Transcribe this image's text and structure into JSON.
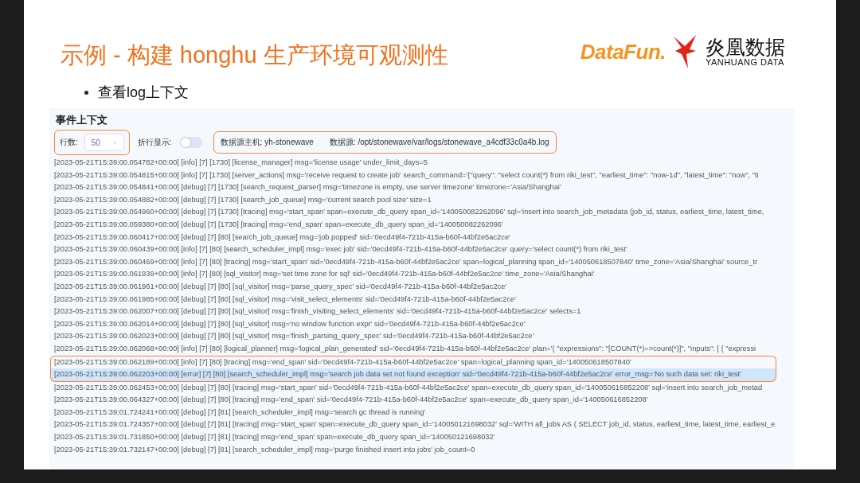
{
  "slide": {
    "title": "示例 - 构建 honghu 生产环境可观测性",
    "bullet": "查看log上下文"
  },
  "logo": {
    "brand": "DataFun.",
    "company": "炎凰数据",
    "company_en": "YANHUANG DATA"
  },
  "panel": {
    "title": "事件上下文",
    "toolbar": {
      "rows_label": "行数:",
      "rows_value": "50",
      "rows_annotated": true,
      "wrap_label": "折行显示:",
      "wrap_on": false,
      "host_label": "数据源主机:",
      "host_value": "yh-stonewave",
      "source_label": "数据源:",
      "source_value": "/opt/stonewave/var/logs/stonewave_a4cdf33c0a4b.log",
      "source_annotated": true
    },
    "rows": [
      {
        "text": "[2023-05-21T15:39:00.054782+00:00] [info] [7] [1730] [license_manager] msg='license usage' under_limit_days=5",
        "selected": false,
        "annotated": false
      },
      {
        "text": "[2023-05-21T15:39:00.054815+00:00] [info] [7] [1730] [server_actions] msg='receive request to create job' search_command='{\"query\": \"select count(*) from riki_test\", \"earliest_time\": \"now-1d\", \"latest_time\": \"now\", \"ti",
        "selected": false,
        "annotated": false
      },
      {
        "text": "[2023-05-21T15:39:00.054841+00:00] [debug] [7] [1730] [search_request_parser] msg='timezone is empty, use server timezone' timezone='Asia/Shanghai'",
        "selected": false,
        "annotated": false
      },
      {
        "text": "[2023-05-21T15:39:00.054882+00:00] [debug] [7] [1730] [search_job_queue] msg='current search pool size' size=1",
        "selected": false,
        "annotated": false
      },
      {
        "text": "[2023-05-21T15:39:00.054960+00:00] [debug] [7] [1730] [tracing] msg='start_span' span=execute_db_query span_id='140050082262096' sql='insert into search_job_metadata (job_id, status, earliest_time, latest_time,",
        "selected": false,
        "annotated": false
      },
      {
        "text": "[2023-05-21T15:39:00.059380+00:00] [debug] [7] [1730] [tracing] msg='end_span' span=execute_db_query span_id='140050082262096'",
        "selected": false,
        "annotated": false
      },
      {
        "text": "[2023-05-21T15:39:00.060417+00:00] [debug] [7] [80] [search_job_queue] msg='job popped' sid='0ecd49f4-721b-415a-b60f-44bf2e5ac2ce'",
        "selected": false,
        "annotated": false
      },
      {
        "text": "[2023-05-21T15:39:00.060439+00:00] [info] [7] [80] [search_scheduler_impl] msg='exec job' sid='0ecd49f4-721b-415a-b60f-44bf2e5ac2ce' query='select count(*) from riki_test'",
        "selected": false,
        "annotated": false
      },
      {
        "text": "[2023-05-21T15:39:00.060469+00:00] [info] [7] [80] [tracing] msg='start_span' sid='0ecd49f4-721b-415a-b60f-44bf2e5ac2ce' span=logical_planning span_id='140050618507840' time_zone='Asia/Shanghai' source_tr",
        "selected": false,
        "annotated": false
      },
      {
        "text": "[2023-05-21T15:39:00.061939+00:00] [info] [7] [80] [sql_visitor] msg='set time zone for sql' sid='0ecd49f4-721b-415a-b60f-44bf2e5ac2ce' time_zone='Asia/Shanghai'",
        "selected": false,
        "annotated": false
      },
      {
        "text": "[2023-05-21T15:39:00.061961+00:00] [debug] [7] [80] [sql_visitor] msg='parse_query_spec' sid='0ecd49f4-721b-415a-b60f-44bf2e5ac2ce'",
        "selected": false,
        "annotated": false
      },
      {
        "text": "[2023-05-21T15:39:00.061985+00:00] [debug] [7] [80] [sql_visitor] msg='visit_select_elements' sid='0ecd49f4-721b-415a-b60f-44bf2e5ac2ce'",
        "selected": false,
        "annotated": false
      },
      {
        "text": "[2023-05-21T15:39:00.062007+00:00] [debug] [7] [80] [sql_visitor] msg='finish_visiting_select_elements' sid='0ecd49f4-721b-415a-b60f-44bf2e5ac2ce' selects=1",
        "selected": false,
        "annotated": false
      },
      {
        "text": "[2023-05-21T15:39:00.062014+00:00] [debug] [7] [80] [sql_visitor] msg='no window function expr' sid='0ecd49f4-721b-415a-b60f-44bf2e5ac2ce'",
        "selected": false,
        "annotated": false
      },
      {
        "text": "[2023-05-21T15:39:00.062023+00:00] [debug] [7] [80] [sql_visitor] msg='finish_parsing_query_spec' sid='0ecd49f4-721b-415a-b60f-44bf2e5ac2ce'",
        "selected": false,
        "annotated": false
      },
      {
        "text": "[2023-05-21T15:39:00.062068+00:00] [info] [7] [80] [logical_planner] msg='logical_plan_generated' sid='0ecd49f4-721b-415a-b60f-44bf2e5ac2ce' plan='{ \"expressions\": \"[COUNT(*)=>count(*)]\", \"inputs\": [ { \"expressi",
        "selected": false,
        "annotated": false
      },
      {
        "text": "[2023-05-21T15:39:00.062189+00:00] [info] [7] [80] [tracing] msg='end_span' sid='0ecd49f4-721b-415a-b60f-44bf2e5ac2ce' span=logical_planning span_id='140050618507840'",
        "selected": false,
        "annotated": true
      },
      {
        "text": "[2023-05-21T15:39:00.062203+00:00] [error] [7] [80] [search_scheduler_impl] msg='search job data set not found exception' sid='0ecd49f4-721b-415a-b60f-44bf2e5ac2ce' error_msg='No such data set: riki_test'",
        "selected": true,
        "annotated": true
      },
      {
        "text": "[2023-05-21T15:39:00.062453+00:00] [debug] [7] [80] [tracing] msg='start_span' sid='0ecd49f4-721b-415a-b60f-44bf2e5ac2ce' span=execute_db_query span_id='140050616852208' sql='insert into search_job_metad",
        "selected": false,
        "annotated": false
      },
      {
        "text": "[2023-05-21T15:39:00.064327+00:00] [debug] [7] [80] [tracing] msg='end_span' sid='0ecd49f4-721b-415a-b60f-44bf2e5ac2ce' span=execute_db_query span_id='140050616852208'",
        "selected": false,
        "annotated": false
      },
      {
        "text": "[2023-05-21T15:39:01.724241+00:00] [debug] [7] [81] [search_scheduler_impl] msg='search gc thread is running'",
        "selected": false,
        "annotated": false
      },
      {
        "text": "[2023-05-21T15:39:01.724357+00:00] [debug] [7] [81] [tracing] msg='start_span' span=execute_db_query span_id='140050121698032' sql='WITH all_jobs AS ( SELECT job_id, status, earliest_time, latest_time, earliest_e",
        "selected": false,
        "annotated": false
      },
      {
        "text": "[2023-05-21T15:39:01.731850+00:00] [debug] [7] [81] [tracing] msg='end_span' span=execute_db_query span_id='140050121698032'",
        "selected": false,
        "annotated": false
      },
      {
        "text": "[2023-05-21T15:39:01.732147+00:00] [debug] [7] [81] [search_scheduler_impl] msg='purge finished insert into jobs' job_count=0",
        "selected": false,
        "annotated": false
      }
    ]
  }
}
